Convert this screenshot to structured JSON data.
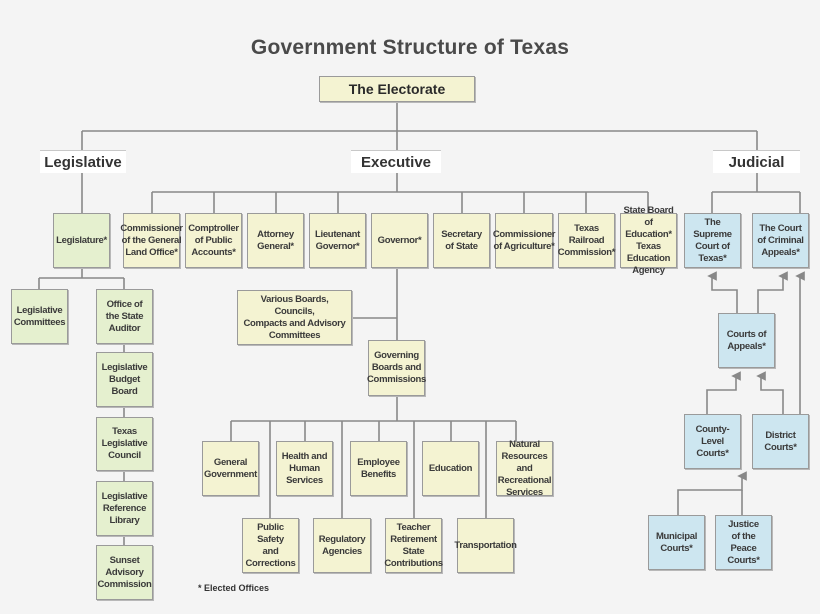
{
  "title": "Government Structure of Texas",
  "colors": {
    "background": "#f4f4f4",
    "executive_fill": "#f4f3d2",
    "legislative_fill": "#e5f0cf",
    "judicial_fill": "#cde6f0",
    "connector": "#888888"
  },
  "electorate": "The Electorate",
  "branches": {
    "legislative": "Legislative",
    "executive": "Executive",
    "judicial": "Judicial"
  },
  "legislative": {
    "legislature": "Legislature*",
    "committees": "Legislative\nCommittees",
    "agencies": [
      "Office of\nthe State\nAuditor",
      "Legislative\nBudget Board",
      "Texas\nLegislative\nCouncil",
      "Legislative\nReference\nLibrary",
      "Sunset\nAdvisory\nCommission"
    ]
  },
  "executive": {
    "offices": [
      "Commissioner\nof the General\nLand Office*",
      "Comptroller\nof Public\nAccounts*",
      "Attorney\nGeneral*",
      "Lieutenant\nGovernor*",
      "Governor*",
      "Secretary\nof State",
      "Commissioner\nof Agriculture*",
      "Texas\nRailroad\nCommission*",
      "State Board\nof Education*\nTexas Education\nAgency"
    ],
    "various_boards": "Various Boards, Councils,\nCompacts and Advisory\nCommittees",
    "governing_boards": "Governing\nBoards and\nCommissions",
    "functions_top": [
      "General\nGovernment",
      "Health and\nHuman\nServices",
      "Employee\nBenefits",
      "Education",
      "Natural\nResources and\nRecreational\nServices"
    ],
    "functions_bottom": [
      "Public Safety\nand\nCorrections",
      "Regulatory\nAgencies",
      "Teacher\nRetirement\nState\nContributions",
      "Transportation"
    ]
  },
  "judicial": {
    "supreme_court": "The Supreme\nCourt of\nTexas*",
    "criminal_appeals": "The Court\nof Criminal\nAppeals*",
    "courts_of_appeals": "Courts of\nAppeals*",
    "county_courts": "County-Level\nCourts*",
    "district_courts": "District\nCourts*",
    "municipal_courts": "Municipal\nCourts*",
    "justice_peace": "Justice\nof the\nPeace\nCourts*"
  },
  "footnote": "* Elected Offices"
}
